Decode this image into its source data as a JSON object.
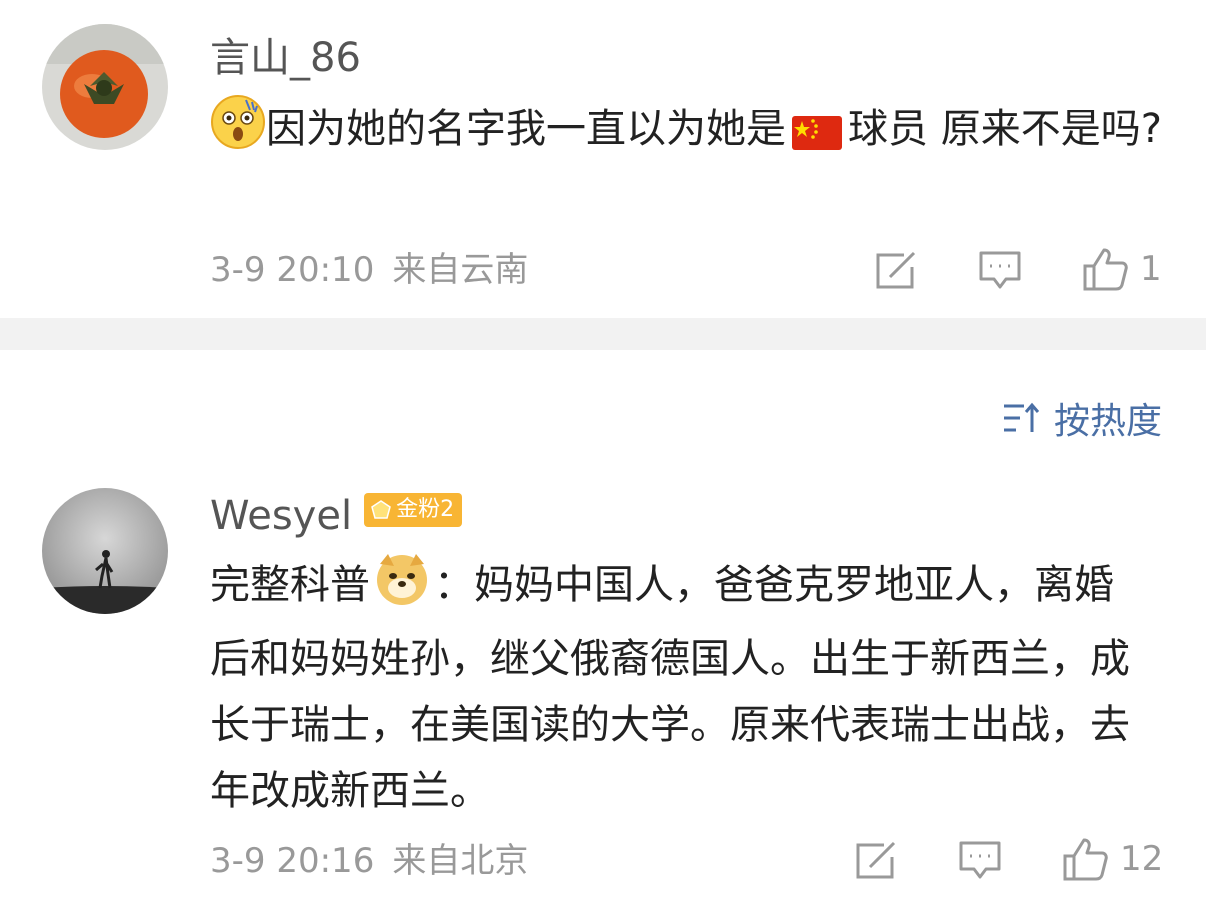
{
  "comments": [
    {
      "user": "言山_86",
      "text_before_flag": "因为她的名字我一直以为她是",
      "text_after_flag": "球员 原来不是吗?",
      "time": "3-9 20:10",
      "location": "来自云南",
      "like_count": "1"
    },
    {
      "user": "Wesyel",
      "badge": "金粉2",
      "text_before_emoji": "完整科普",
      "text_after_emoji": "：妈妈中国人，爸爸克罗地亚人，离婚后和妈妈姓孙，继父俄裔德国人。出生于新西兰，成长于瑞士，在美国读的大学。原来代表瑞士出战，去年改成新西兰。",
      "time": "3-9 20:16",
      "location": "来自北京",
      "like_count": "12"
    }
  ],
  "sort": {
    "label": "按热度"
  },
  "colors": {
    "link": "#4a6fa5",
    "muted": "#999999",
    "badge": "#f8b534",
    "divider": "#f2f2f2"
  }
}
